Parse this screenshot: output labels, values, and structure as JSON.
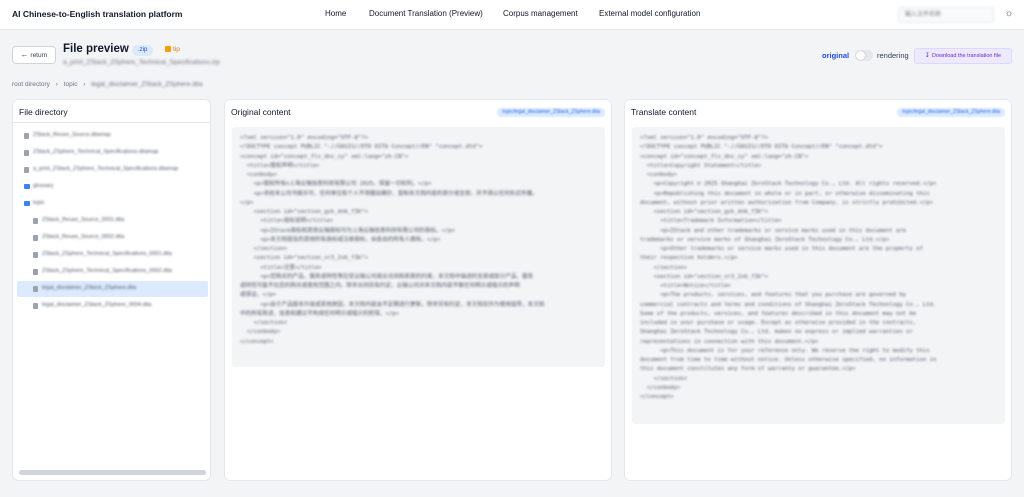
{
  "app": {
    "brand": "AI Chinese-to-English translation platform",
    "nav": [
      {
        "label": "Home"
      },
      {
        "label": "Document Translation (Preview)"
      },
      {
        "label": "Corpus management"
      },
      {
        "label": "External model configuration"
      }
    ],
    "search_placeholder": "输入文件名称",
    "theme_icon": "sun-icon"
  },
  "header": {
    "back_label": "return",
    "title": "File preview",
    "ext_badge": ".zip",
    "tip_label": "tip",
    "subtitle": "a_print_ZStack_ZSphere_Technical_Specifications.zip",
    "original_label": "original",
    "rendering_label": "rendering",
    "rendering_on": false,
    "download_label": "Download the translation file"
  },
  "breadcrumb": [
    "root directory",
    "topic",
    "legal_disclaimer_ZStack_ZSphere.dita"
  ],
  "directory": {
    "title": "File directory",
    "items": [
      {
        "label": "ZStack_Reuse_Source.ditamap",
        "type": "file",
        "selected": false
      },
      {
        "label": "ZStack_ZSphere_Technical_Specifications.ditamap",
        "type": "file",
        "selected": false
      },
      {
        "label": "a_print_ZStack_ZSphere_Technical_Specifications.ditamap",
        "type": "file",
        "selected": false
      },
      {
        "label": "glossary",
        "type": "folder",
        "selected": false
      },
      {
        "label": "topic",
        "type": "folder",
        "selected": false
      },
      {
        "label": "ZStack_Reuse_Source_0001.dita",
        "type": "file",
        "selected": false
      },
      {
        "label": "ZStack_Reuse_Source_0002.dita",
        "type": "file",
        "selected": false
      },
      {
        "label": "ZStack_ZSphere_Technical_Specifications_0001.dita",
        "type": "file",
        "selected": false
      },
      {
        "label": "ZStack_ZSphere_Technical_Specifications_0002.dita",
        "type": "file",
        "selected": false
      },
      {
        "label": "legal_disclaimer_ZStack_ZSphere.dita",
        "type": "file",
        "selected": true
      },
      {
        "label": "legal_disclaimer_ZStack_ZSphere_0004.dita",
        "type": "file",
        "selected": false
      }
    ]
  },
  "original": {
    "title": "Original content",
    "tag": "topic/legal_disclaimer_ZStack_ZSphere.dita",
    "lines": [
      "<?xml version=\"1.0\" encoding=\"UTF-8\"?>",
      "<!DOCTYPE concept PUBLIC \"-//OASIS//DTD DITA Concept//EN\" \"concept.dtd\">",
      "<concept id=\"concept_fls_dnz_sy\" xml:lang=\"zh-CN\">",
      "  <title>版权声明</title>",
      "  <conbody>",
      "    <p>版权所有©上海云轴信息科技有限公司 2025。保留一切权利。</p>",
      "    <p>非经本公司书面许可，任何单位和个人不得擅自摘抄、复制本文档内容的部分或全部，并不得以任何形式传播。",
      "</p>",
      "    <section id=\"section_gzk_dnb_f3b\">",
      "      <title>商标说明</title>",
      "      <p>ZStack商标和其他云轴商标均为上海云轴信息科技有限公司的商标。</p>",
      "      <p>本文档提及的其他所有商标或注册商标，由各自的所有人拥有。</p>",
      "    </section>",
      "    <section id=\"section_xr3_2vb_f3b\">",
      "      <title>注意</title>",
      "      <p>您购买的产品、服务或特性等应受云轴公司商业合同和条款的约束，本文档中描述的全部或部分产品、服务",
      "或特性可能不在您的购买或使用范围之内。除非合同另有约定，云轴公司对本文档内容不做任何明示或暗示的声明",
      "或保证。</p>",
      "      <p>由于产品版本升级或其他原因，本文档内容会不定期进行更新。除非另有约定，本文档仅作为使用指导，本文档",
      "中的所有陈述、信息和建议不构成任何明示或暗示的担保。</p>",
      "    </section>",
      "  </conbody>",
      "</concept>"
    ]
  },
  "translated": {
    "title": "Translate content",
    "tag": "topic/legal_disclaimer_ZStack_ZSphere.dita",
    "lines": [
      "<?xml version=\"1.0\" encoding=\"UTF-8\"?>",
      "<!DOCTYPE concept PUBLIC \"-//OASIS//DTD DITA Concept//EN\" \"concept.dtd\">",
      "<concept id=\"concept_fls_dnz_sy\" xml:lang=\"zh-CN\">",
      "  <title>Copyright Statement</title>",
      "  <conbody>",
      "    <p>Copyright © 2025 Shanghai ZeroStack Technology Co., Ltd. All rights reserved.</p>",
      "    <p>Republishing this document in whole or in part, or otherwise disseminating this",
      "document, without prior written authorization from Company, is strictly prohibited.</p>",
      "    <section id=\"section_gzk_dnb_f3b\">",
      "      <title>Trademark Information</title>",
      "      <p>ZStack and other trademarks or service marks used in this document are",
      "trademarks or service marks of Shanghai ZeroStack Technology Co., Ltd.</p>",
      "      <p>Other trademarks or service marks used in this document are the property of",
      "their respective holders.</p>",
      "    </section>",
      "    <section id=\"section_xr3_2vb_f3b\">",
      "      <title>Notice</title>",
      "      <p>The products, services, and features that you purchase are governed by",
      "commercial contracts and terms and conditions of Shanghai ZeroStack Technology Co., Ltd.",
      "Some of the products, services, and features described in this document may not be",
      "included in your purchase or usage. Except as otherwise provided in the contracts,",
      "Shanghai ZeroStack Technology Co., Ltd. makes no express or implied warranties or",
      "representations in connection with this document.</p>",
      "      <p>This document is for your reference only. We reserve the right to modify this",
      "document from time to time without notice. Unless otherwise specified, no information in",
      "this document constitutes any form of warranty or guarantee.</p>",
      "    </section>",
      "  </conbody>",
      "</concept>"
    ]
  },
  "colors": {
    "accent": "#1d4ed8",
    "download_bg": "#ede9fe",
    "download_text": "#6d28d9",
    "selected_bg": "#dbeafe",
    "folder_icon": "#3b82f6",
    "tip": "#d97706"
  }
}
